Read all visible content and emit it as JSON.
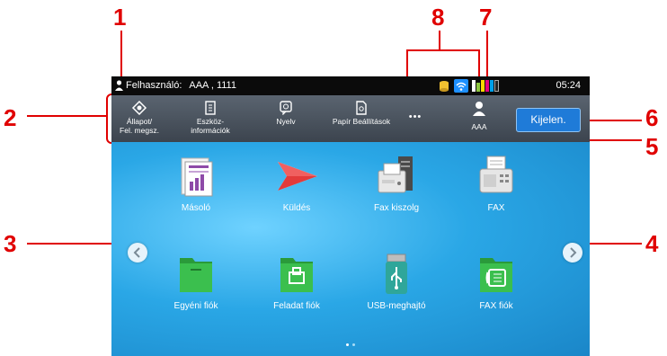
{
  "callouts": {
    "c1": "1",
    "c2": "2",
    "c3": "3",
    "c4": "4",
    "c5": "5",
    "c6": "6",
    "c7": "7",
    "c8": "8"
  },
  "status": {
    "user_label": "Felhasználó:",
    "user_value": "AAA , 1111",
    "time": "05:24"
  },
  "quickbar": {
    "items": [
      {
        "icon": "status-icon",
        "label_l1": "Állapot/",
        "label_l2": "Fel. megsz."
      },
      {
        "icon": "device-info-icon",
        "label_l1": "Eszköz-",
        "label_l2": "információk"
      },
      {
        "icon": "language-icon",
        "label_l1": "Nyelv",
        "label_l2": ""
      },
      {
        "icon": "paper-settings-icon",
        "label_l1": "Papír Beállítások",
        "label_l2": ""
      }
    ],
    "more_label": "•••",
    "user_name": "AAA",
    "logout_label": "Kijelen."
  },
  "home": {
    "tiles": [
      {
        "icon": "copy-icon",
        "label": "Másoló"
      },
      {
        "icon": "send-icon",
        "label": "Küldés"
      },
      {
        "icon": "fax-server-icon",
        "label": "Fax kiszolg"
      },
      {
        "icon": "fax-icon",
        "label": "FAX"
      },
      {
        "icon": "custom-box-icon",
        "label": "Egyéni fiók"
      },
      {
        "icon": "job-box-icon",
        "label": "Feladat fiók"
      },
      {
        "icon": "usb-drive-icon",
        "label": "USB-meghajtó"
      },
      {
        "icon": "fax-box-icon",
        "label": "FAX fiók"
      }
    ],
    "pages_total": 2,
    "page_current": 1
  },
  "colors": {
    "callout": "#e00000",
    "logout_button": "#1f7bd8",
    "quickbar": "#4a525c",
    "home_bg": "#2aa7e6"
  }
}
